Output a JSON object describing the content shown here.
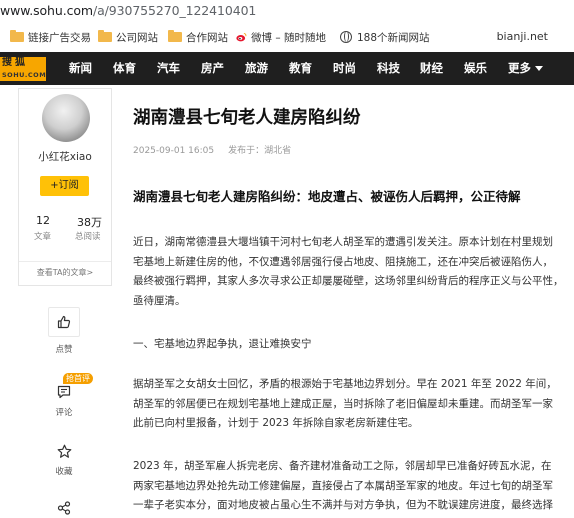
{
  "browser": {
    "url_host": "www.sohu.com",
    "url_path": "/a/930755270_122410401",
    "bookmarks": [
      {
        "label": "链接广告交易",
        "icon": "folder-icon"
      },
      {
        "label": "公司网站",
        "icon": "folder-icon"
      },
      {
        "label": "合作网站",
        "icon": "folder-icon"
      },
      {
        "label": "微博 – 随时随地",
        "icon": "weibo-icon"
      },
      {
        "label": "188个新闻网站",
        "icon": "globe-icon"
      }
    ],
    "bookmarks_right": "bianji.net"
  },
  "nav": {
    "logo_line1": "搜狐",
    "logo_line2": "SOHU.COM",
    "items": [
      "新闻",
      "体育",
      "汽车",
      "房产",
      "旅游",
      "教育",
      "时尚",
      "科技",
      "财经",
      "娱乐",
      "更多"
    ]
  },
  "author": {
    "name": "小红花xiao",
    "follow_label": "+订阅",
    "articles_count": "12",
    "articles_label": "文章",
    "views_count": "38万",
    "views_label": "总阅读",
    "see_more": "查看TA的文章>"
  },
  "actions": {
    "like_label": "点赞",
    "comment_badge": "抢首评",
    "comment_label": "评论",
    "favorite_label": "收藏"
  },
  "article": {
    "title": "湖南澧县七旬老人建房陷纠纷",
    "date": "2025-09-01 16:05",
    "location": "发布于：湖北省",
    "subtitle": "湖南澧县七旬老人建房陷纠纷：地皮遭占、被诬伤人后羁押，公正待解",
    "p1": [
      "近日，湖南常德澧县大堰垱镇干河村七旬老人胡圣军的遭遇引发关注。原本计划在村里规划",
      "宅基地上新建住房的他，不仅遭遇邻居强行侵占地皮、阻挠施工，还在冲突后被诬陷伤人，",
      "最终被强行羁押，其家人多次寻求公正却屡屡碰壁，这场邻里纠纷背后的程序正义与公平性，",
      "亟待厘清。"
    ],
    "h1": "一、宅基地边界起争执，退让难换安宁",
    "p2": [
      "据胡圣军之女胡女士回忆，矛盾的根源始于宅基地边界划分。早在 2021 年至 2022 年间，",
      "胡圣军的邻居便已在规划宅基地上建成正屋，当时拆除了老旧偏屋却未重建。而胡圣军一家",
      "此前已向村里报备，计划于 2023 年拆除自家老房新建住宅。"
    ],
    "p3": [
      "2023 年，胡圣军雇人拆完老房、备齐建材准备动工之际，邻居却早已准备好砖瓦水泥，在",
      "两家宅基地边界处抢先动工修建偏屋，直接侵占了本属胡圣军家的地皮。年过七旬的胡圣军",
      "一辈子老实本分，面对地皮被占虽心生不满并与对方争执，但为不耽误建房进度，最终选择"
    ]
  }
}
